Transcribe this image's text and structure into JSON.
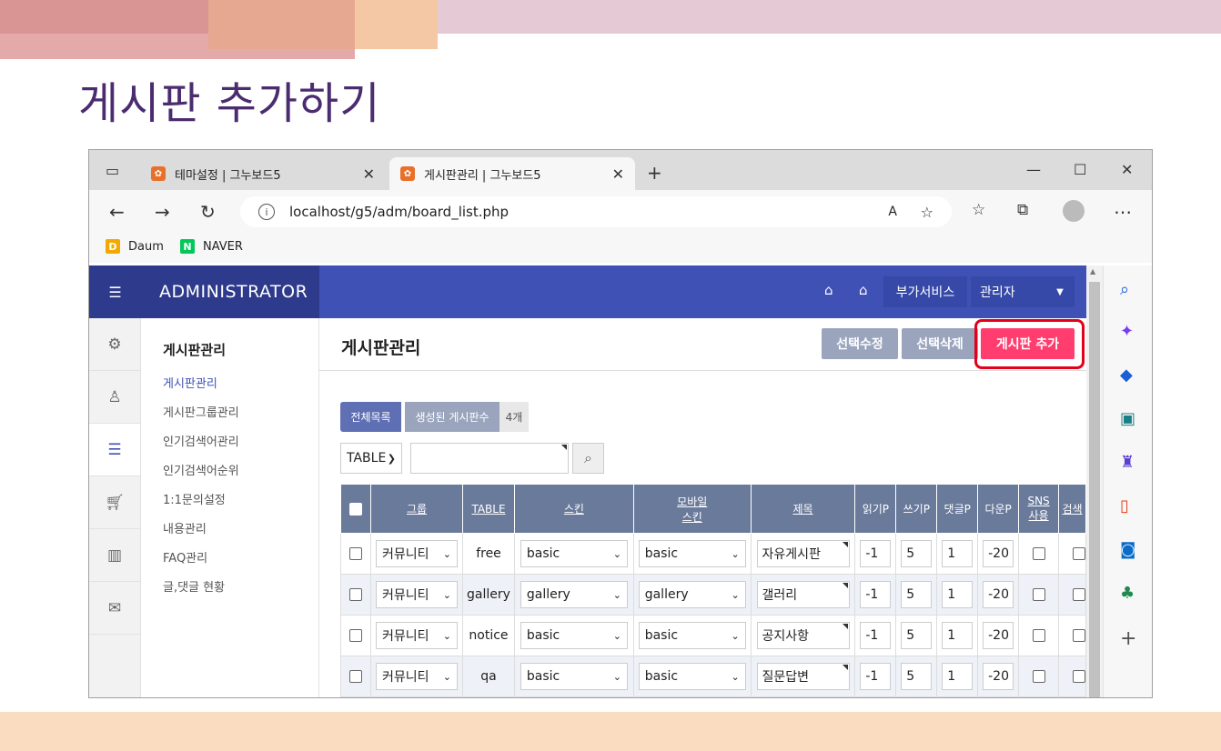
{
  "slide": {
    "title": "게시판 추가하기"
  },
  "browser": {
    "tabs": [
      {
        "label": "테마설정 | 그누보드5"
      },
      {
        "label": "게시판관리 | 그누보드5"
      }
    ],
    "url": "localhost/g5/adm/board_list.php",
    "bookmarks": [
      {
        "label": "Daum"
      },
      {
        "label": "NAVER"
      }
    ]
  },
  "admin": {
    "brand": "ADMINISTRATOR",
    "header_buttons": {
      "service": "부가서비스",
      "admin": "관리자"
    },
    "lnb_title": "게시판관리",
    "lnb_items": [
      "게시판관리",
      "게시판그룹관리",
      "인기검색어관리",
      "인기검색어순위",
      "1:1문의설정",
      "내용관리",
      "FAQ관리",
      "글,댓글 현황"
    ],
    "page_title": "게시판관리",
    "buttons": {
      "edit": "선택수정",
      "delete": "선택삭제",
      "add": "게시판 추가"
    },
    "filters": {
      "all": "전체목록",
      "created": "생성된 게시판수",
      "count": "4개"
    },
    "search_select": "TABLE",
    "table": {
      "headers": [
        "그룹",
        "TABLE",
        "스킨",
        "모바일 스킨",
        "제목",
        "읽기P",
        "쓰기P",
        "댓글P",
        "다운P",
        "SNS 사용",
        "검색"
      ],
      "mobile_header_1": "모바일",
      "mobile_header_2": "스킨",
      "sns_header_1": "SNS",
      "sns_header_2": "사용",
      "rows": [
        {
          "group": "커뮤니티",
          "table": "free",
          "skin": "basic",
          "mobile_skin": "basic",
          "subject": "자유게시판",
          "read": "-1",
          "write": "5",
          "comment": "1",
          "download": "-20"
        },
        {
          "group": "커뮤니티",
          "table": "gallery",
          "skin": "gallery",
          "mobile_skin": "gallery",
          "subject": "갤러리",
          "read": "-1",
          "write": "5",
          "comment": "1",
          "download": "-20"
        },
        {
          "group": "커뮤니티",
          "table": "notice",
          "skin": "basic",
          "mobile_skin": "basic",
          "subject": "공지사항",
          "read": "-1",
          "write": "5",
          "comment": "1",
          "download": "-20"
        },
        {
          "group": "커뮤니티",
          "table": "qa",
          "skin": "basic",
          "mobile_skin": "basic",
          "subject": "질문답변",
          "read": "-1",
          "write": "5",
          "comment": "1",
          "download": "-20"
        }
      ]
    }
  },
  "colors": {
    "header": "#3f51b5",
    "add_button": "#ff3d6e",
    "highlight_box": "#e3001b",
    "title": "#4b2c6e"
  }
}
